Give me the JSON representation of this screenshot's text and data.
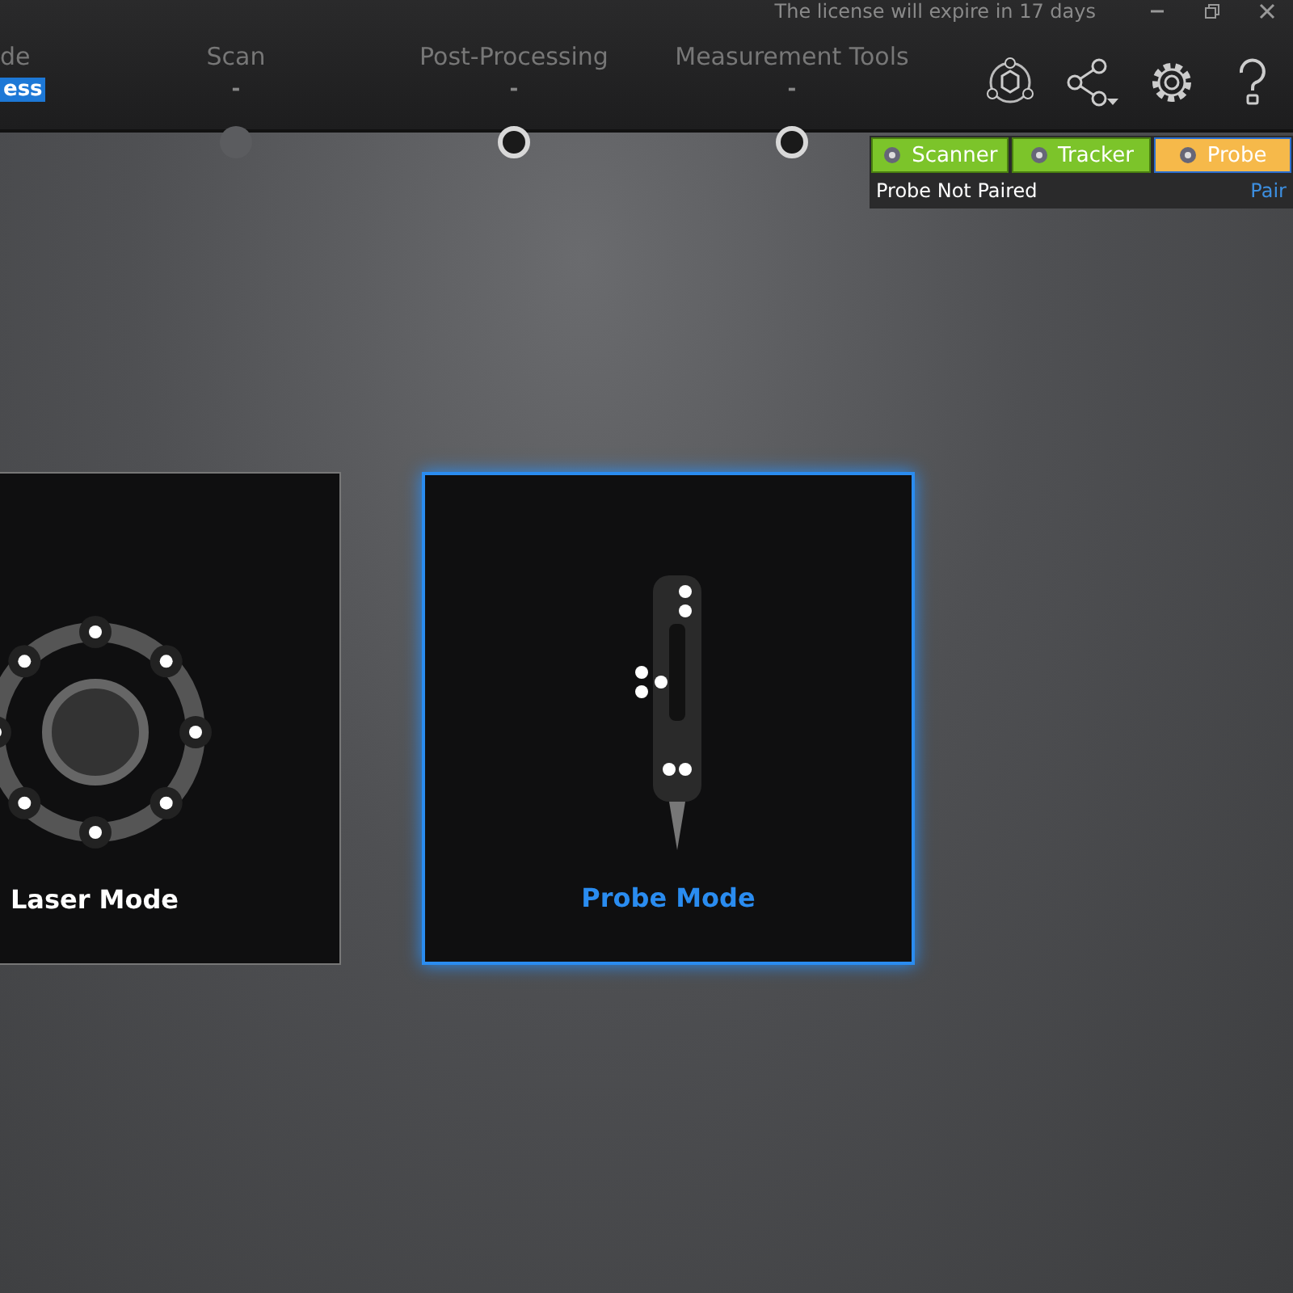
{
  "title_bar": {
    "notice": "The license will expire in 17 days"
  },
  "steps": [
    {
      "label": "de",
      "status": "ess",
      "selected": true
    },
    {
      "label": "Scan",
      "status": "-",
      "kind": "filled",
      "selected": false
    },
    {
      "label": "Post-Processing",
      "status": "-",
      "kind": "ring",
      "selected": false
    },
    {
      "label": "Measurement Tools",
      "status": "-",
      "kind": "ring",
      "selected": false
    }
  ],
  "device_tabs": [
    {
      "label": "Scanner",
      "selected": false
    },
    {
      "label": "Tracker",
      "selected": false
    },
    {
      "label": "Probe",
      "selected": true
    }
  ],
  "device_status": {
    "text": "Probe Not Paired",
    "link": "Pair"
  },
  "modes": [
    {
      "label": "Laser Mode",
      "kind": "laser",
      "selected": false
    },
    {
      "label": "Probe Mode",
      "kind": "probe",
      "selected": true
    }
  ]
}
